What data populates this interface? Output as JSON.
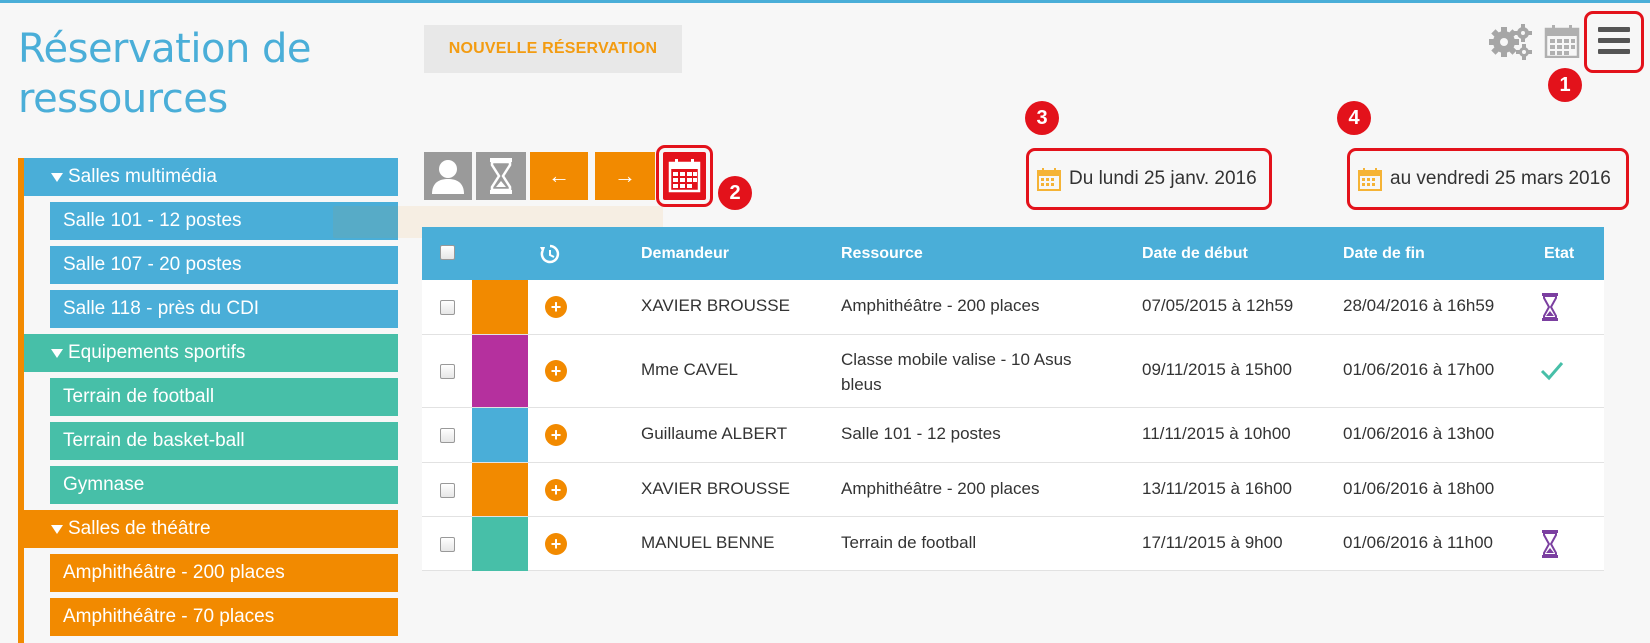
{
  "app": {
    "title_line1": "Réservation de",
    "title_line2": "ressources"
  },
  "header": {
    "new_reservation_label": "NOUVELLE RÉSERVATION"
  },
  "toolbar_icons": [
    "user-icon",
    "hourglass-icon",
    "arrow-left-icon",
    "arrow-right-icon",
    "calendar-icon"
  ],
  "toolbar": {
    "prev_label": "←",
    "next_label": "→"
  },
  "date_range": {
    "from": "Du lundi 25 janv. 2016",
    "to": "au vendredi 25 mars 2016"
  },
  "callouts": [
    "1",
    "2",
    "3",
    "4"
  ],
  "sidebar": {
    "groups": [
      {
        "label": "Salles multimédia",
        "color": "#4aaed8",
        "items": [
          "Salle 101 - 12 postes",
          "Salle 107 - 20 postes",
          "Salle 118 - près du CDI"
        ]
      },
      {
        "label": "Equipements sportifs",
        "color": "#47bfa8",
        "items": [
          "Terrain de football",
          "Terrain de basket-ball",
          "Gymnase"
        ]
      },
      {
        "label": "Salles de théâtre",
        "color": "#f28a00",
        "items": [
          "Amphithéâtre - 200 places",
          "Amphithéâtre - 70 places"
        ]
      }
    ]
  },
  "table": {
    "headers": {
      "demandeur": "Demandeur",
      "ressource": "Ressource",
      "debut": "Date de début",
      "fin": "Date de fin",
      "etat": "Etat"
    },
    "rows": [
      {
        "color": "#f28a00",
        "demandeur": "XAVIER BROUSSE",
        "ressource": "Amphithéâtre - 200 places",
        "debut": "07/05/2015 à 12h59",
        "fin": "28/04/2016 à 16h59",
        "etat_icon": "hourglass-icon"
      },
      {
        "color": "#b5309e",
        "demandeur": "Mme CAVEL",
        "ressource_l1": "Classe mobile valise - 10 Asus",
        "ressource_l2": "bleus",
        "debut": "09/11/2015 à 15h00",
        "fin": "01/06/2016 à 17h00",
        "etat_icon": "check-icon"
      },
      {
        "color": "#4aaed8",
        "demandeur": "Guillaume ALBERT",
        "ressource": "Salle 101 - 12 postes",
        "debut": "11/11/2015 à 10h00",
        "fin": "01/06/2016 à 13h00",
        "etat_icon": ""
      },
      {
        "color": "#f28a00",
        "demandeur": "XAVIER BROUSSE",
        "ressource": "Amphithéâtre - 200 places",
        "debut": "13/11/2015 à 16h00",
        "fin": "01/06/2016 à 18h00",
        "etat_icon": ""
      },
      {
        "color": "#47bfa8",
        "demandeur": "MANUEL BENNE",
        "ressource": "Terrain de football",
        "debut": "17/11/2015 à 9h00",
        "fin": "01/06/2016 à 11h00",
        "etat_icon": "hourglass-icon"
      }
    ]
  }
}
